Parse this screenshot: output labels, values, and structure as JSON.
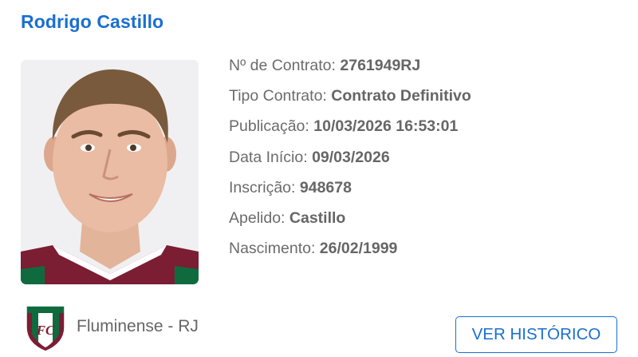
{
  "player": {
    "name": "Rodrigo Castillo",
    "photo_icon": "player-portrait"
  },
  "details": [
    {
      "label": "Nº de Contrato:",
      "value": "2761949RJ"
    },
    {
      "label": "Tipo Contrato:",
      "value": "Contrato Definitivo"
    },
    {
      "label": "Publicação:",
      "value": "10/03/2026 16:53:01"
    },
    {
      "label": "Data Início:",
      "value": "09/03/2026"
    },
    {
      "label": "Inscrição:",
      "value": "948678"
    },
    {
      "label": "Apelido:",
      "value": "Castillo"
    },
    {
      "label": "Nascimento:",
      "value": "26/02/1999"
    }
  ],
  "club": {
    "name": "Fluminense - RJ",
    "crest_icon": "fluminense-crest"
  },
  "actions": {
    "history_label": "VER HISTÓRICO"
  },
  "colors": {
    "accent": "#1a6fd0",
    "text": "#666666",
    "club_maroon": "#7b1d33",
    "club_green": "#0f6b3e"
  }
}
